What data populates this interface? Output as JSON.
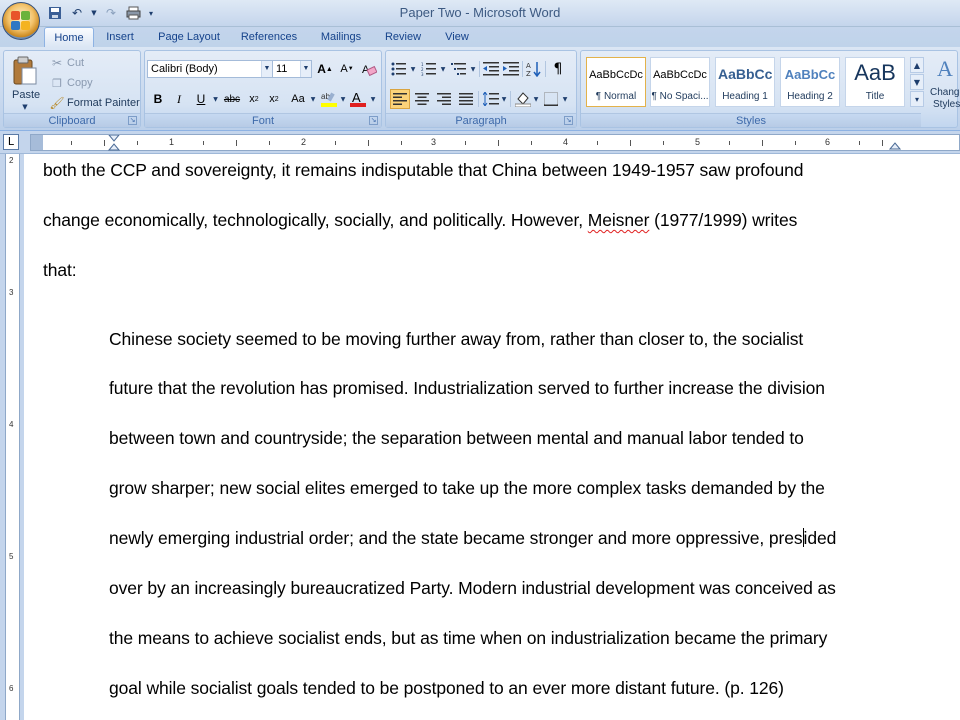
{
  "window": {
    "title": "Paper Two - Microsoft Word"
  },
  "tabs": [
    "Home",
    "Insert",
    "Page Layout",
    "References",
    "Mailings",
    "Review",
    "View"
  ],
  "clipboard": {
    "paste": "Paste",
    "cut": "Cut",
    "copy": "Copy",
    "format_painter": "Format Painter",
    "label": "Clipboard"
  },
  "font": {
    "name": "Calibri (Body)",
    "size": "11",
    "label": "Font"
  },
  "paragraph": {
    "label": "Paragraph"
  },
  "styles": {
    "label": "Styles",
    "change_styles": [
      "Change",
      "Styles"
    ],
    "items": [
      {
        "sample": "AaBbCcDc",
        "name": "¶ Normal"
      },
      {
        "sample": "AaBbCcDc",
        "name": "¶ No Spaci..."
      },
      {
        "sample": "AaBbCc",
        "name": "Heading 1"
      },
      {
        "sample": "AaBbCc",
        "name": "Heading 2"
      },
      {
        "sample": "AaB",
        "name": "Title"
      }
    ]
  },
  "ruler": {
    "numbers": [
      "1",
      "1",
      "2",
      "3",
      "4",
      "5",
      "6"
    ]
  },
  "vruler": {
    "numbers": [
      "2",
      "3",
      "4",
      "5",
      "6"
    ]
  },
  "document": {
    "lines": [
      "both the CCP and sovereignty, it remains indisputable that China between 1949-1957 saw profound",
      "that:",
      "Chinese society seemed to be moving further away from, rather than closer to, the socialist",
      "future that the revolution has promised.  Industrialization served to further increase the division",
      "between town and countryside; the separation between mental and manual labor tended to",
      "grow sharper; new social elites emerged to take up the more complex tasks demanded by the",
      "over by an increasingly bureaucratized Party.  Modern industrial development was conceived as",
      "the means to achieve socialist ends, but as time when on industrialization became the primary",
      "goal while socialist goals tended to be postponed to an ever more distant future. (p. 126)"
    ],
    "line2": {
      "before": "change economically, technologically, socially, and politically.  However, ",
      "misspelled": "Meisner",
      "after": " (1977/1999) writes"
    },
    "line7": {
      "before": "newly emerging industrial order; and the state became stronger and more oppressive, pres",
      "after": "ided"
    }
  }
}
